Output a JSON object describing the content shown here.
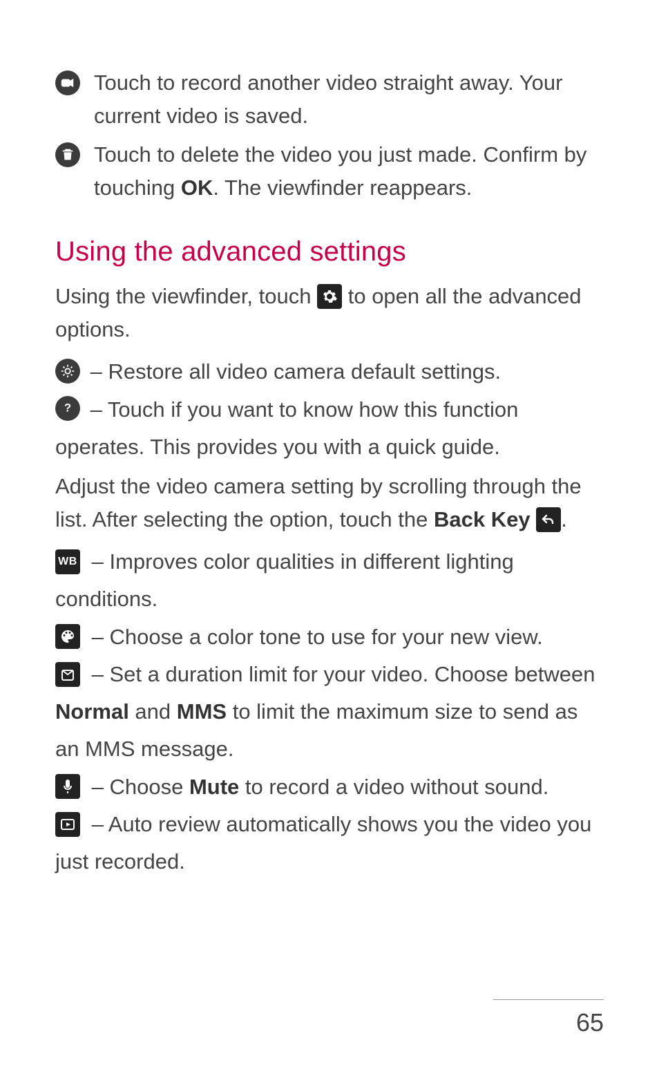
{
  "introItems": [
    {
      "icon": "camcorder-icon",
      "text": "Touch to record another video straight away. Your current video is saved."
    },
    {
      "icon": "trash-icon",
      "pre": "Touch to delete the video you just made. Confirm by touching ",
      "bold": "OK",
      "post": ". The viewfinder reappears."
    }
  ],
  "heading": "Using the advanced settings",
  "intro_pre": "Using the viewfinder, touch ",
  "intro_post": " to open all the advanced options.",
  "gear_icon": "gear-icon",
  "bullet1": " – Restore all video camera default settings.",
  "bullet2": " – Touch if you want to know how this function operates. This provides you with a quick guide.",
  "paragraph1_pre": "Adjust the video camera setting by scrolling through the list. After selecting the option, touch the ",
  "paragraph1_bold": "Back Key",
  "paragraph1_post": " ",
  "paragraph1_tail": ".",
  "wb_label": "WB",
  "wb_text": " – Improves color qualities in different lighting conditions.",
  "palette_text": " – Choose a color tone to use for your new view.",
  "timer_pre": " – Set a duration limit for your video. Choose between ",
  "timer_b1": "Normal",
  "timer_mid": " and ",
  "timer_b2": "MMS",
  "timer_post": " to limit the maximum size to send as an MMS message.",
  "mic_pre": " – Choose ",
  "mic_bold": "Mute",
  "mic_post": " to record a video without sound.",
  "play_text": " – Auto review automatically shows you the video you just recorded.",
  "pageNumber": "65"
}
